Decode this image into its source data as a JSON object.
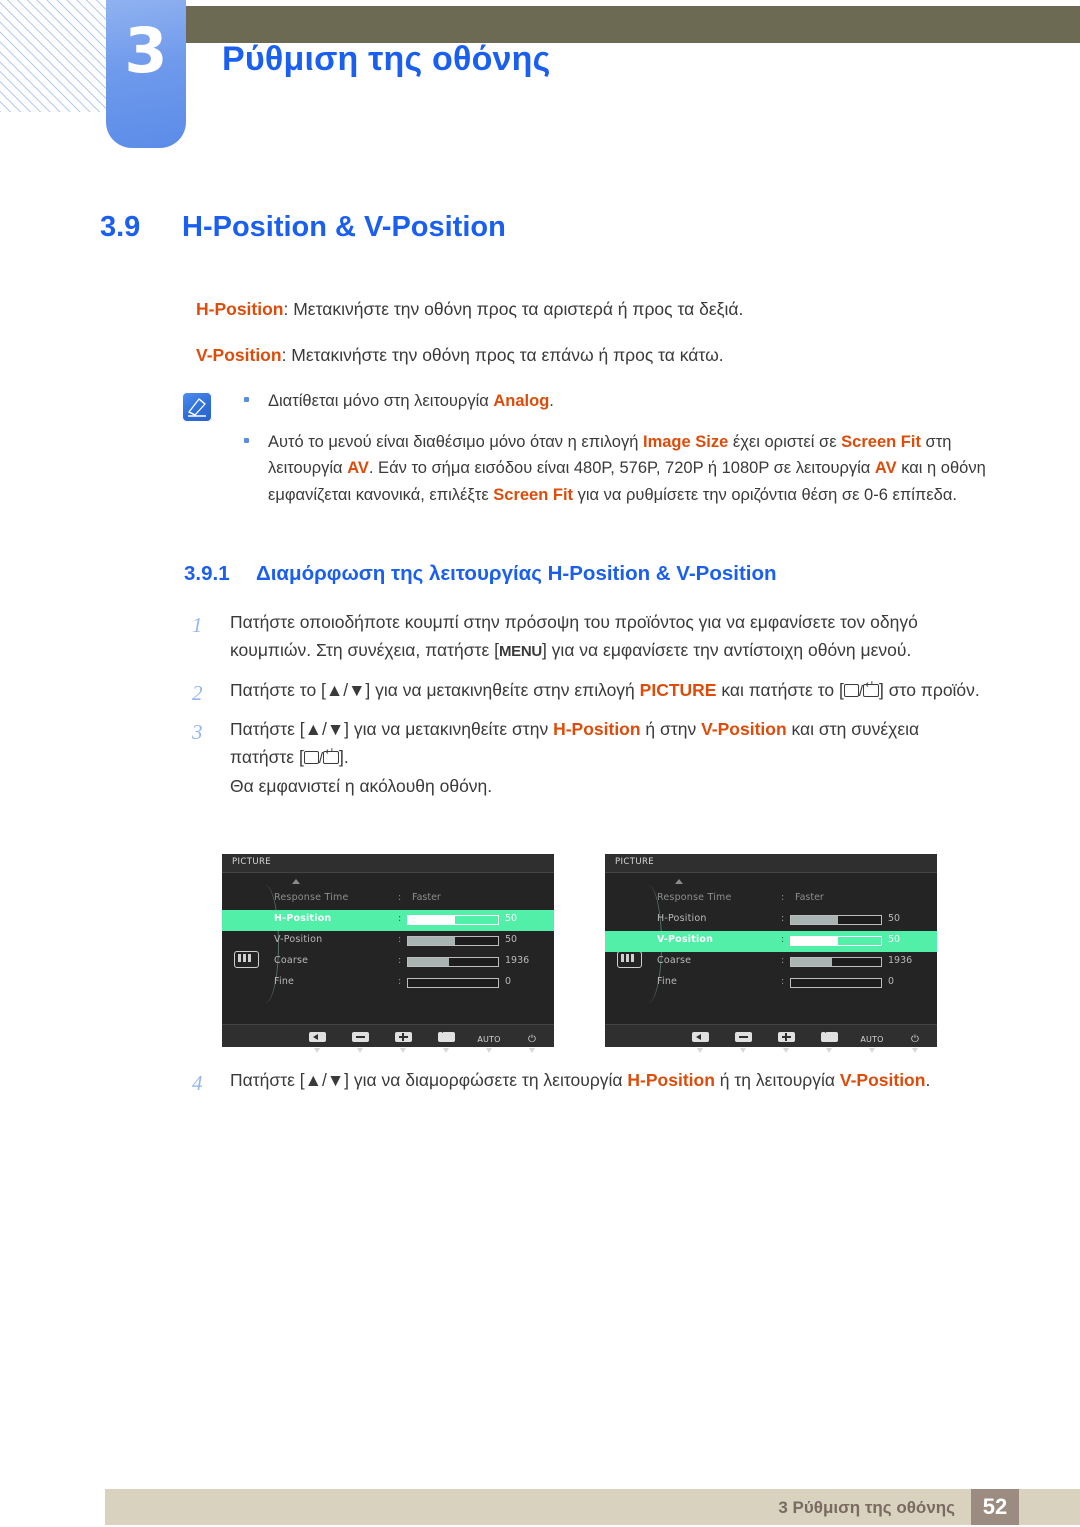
{
  "header": {
    "chapter_number": "3",
    "chapter_title": "Ρύθμιση της οθόνης"
  },
  "section": {
    "number": "3.9",
    "title": "H-Position & V-Position"
  },
  "paragraphs": {
    "p1_term": "H-Position",
    "p1_rest": ": Μετακινήστε την οθόνη προς τα αριστερά ή προς τα δεξιά.",
    "p2_term": "V-Position",
    "p2_rest": ": Μετακινήστε την οθόνη προς τα επάνω ή προς τα κάτω."
  },
  "note": {
    "icon": "note-pencil-icon",
    "bullet1_pre": "Διατίθεται μόνο στη λειτουργία ",
    "bullet1_term": "Analog",
    "bullet1_post": ".",
    "bullet2_a": "Αυτό το μενού είναι διαθέσιμο μόνο όταν η επιλογή ",
    "bullet2_t1": "Image Size",
    "bullet2_b": " έχει οριστεί σε ",
    "bullet2_t2": "Screen Fit",
    "bullet2_c": " στη λειτουργία ",
    "bullet2_t3": "AV",
    "bullet2_d": ". Εάν το σήμα εισόδου είναι 480P, 576P, 720P ή 1080P σε λειτουργία ",
    "bullet2_t4": "AV",
    "bullet2_e": " και η οθόνη εμφανίζεται κανονικά, επιλέξτε ",
    "bullet2_t5": "Screen Fit",
    "bullet2_f": " για να ρυθμίσετε την οριζόντια θέση σε 0-6 επίπεδα."
  },
  "subsection": {
    "number": "3.9.1",
    "title": "Διαμόρφωση της λειτουργίας H-Position & V-Position"
  },
  "steps": [
    {
      "number": "1",
      "a": "Πατήστε οποιοδήποτε κουμπί στην πρόσοψη του προϊόντος για να εμφανίσετε τον οδηγό κουμπιών. Στη συνέχεια, πατήστε [",
      "key": "MENU",
      "b": "] για να εμφανίσετε την αντίστοιχη οθόνη μενού."
    },
    {
      "number": "2",
      "a": "Πατήστε το [▲/▼] για να μετακινηθείτε στην επιλογή ",
      "term": "PICTURE",
      "b": " και πατήστε το [",
      "c": "] στο προϊόν."
    },
    {
      "number": "3",
      "a": "Πατήστε [▲/▼] για να μετακινηθείτε στην ",
      "term1": "H-Position",
      "b": " ή στην ",
      "term2": "V-Position",
      "c": " και στη συνέχεια πατήστε [",
      "d": "].",
      "sub": "Θα εμφανιστεί η ακόλουθη οθόνη."
    },
    {
      "number": "4",
      "a": "Πατήστε [▲/▼] για να διαμορφώσετε τη λειτουργία ",
      "term1": "H-Position",
      "b": " ή τη λειτουργία ",
      "term2": "V-Position",
      "c": "."
    }
  ],
  "osd": {
    "title": "PICTURE",
    "category_icon": "picture-bars-icon",
    "rows": [
      {
        "label": "Response Time",
        "value_text": "Faster",
        "type": "text"
      },
      {
        "label": "H-Position",
        "number": "50",
        "fill": 52,
        "type": "slider"
      },
      {
        "label": "V-Position",
        "number": "50",
        "fill": 52,
        "type": "slider"
      },
      {
        "label": "Coarse",
        "number": "1936",
        "fill": 45,
        "type": "slider"
      },
      {
        "label": "Fine",
        "number": "0",
        "fill": 0,
        "type": "slider"
      }
    ],
    "left_selected": "H-Position",
    "right_selected": "V-Position",
    "buttons": [
      {
        "icon": "arrow-left-icon",
        "label": ""
      },
      {
        "icon": "minus-icon",
        "label": ""
      },
      {
        "icon": "plus-icon",
        "label": ""
      },
      {
        "icon": "enter-icon",
        "label": ""
      },
      {
        "icon": "auto-label",
        "label": "AUTO"
      },
      {
        "icon": "power-icon",
        "label": "⏻"
      }
    ],
    "highlight_color": "#52efa9"
  },
  "footer": {
    "text": "3 Ρύθμιση της οθόνης",
    "page": "52"
  }
}
